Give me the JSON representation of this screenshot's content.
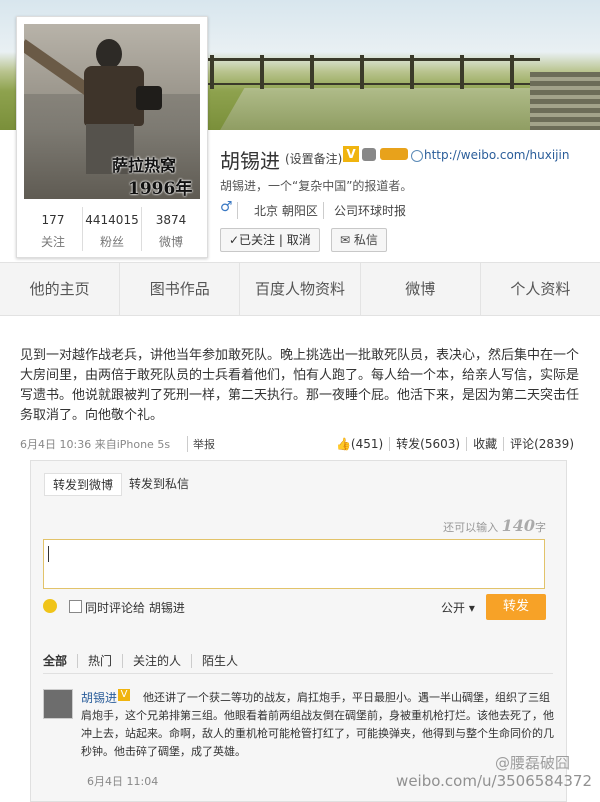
{
  "profile": {
    "name": "胡锡进",
    "note_label": "(设置备注)",
    "verified_badge": "V",
    "url": "http://weibo.com/huxijin",
    "intro": "胡锡进，一个“复杂中国”的报道者。",
    "gender_icon": "♂",
    "location": "北京 朝阳区",
    "company": "公司环球时报",
    "follow_label": "✓已关注 | 取消",
    "message_label": "✉ 私信",
    "avatar_caption_line1": "萨拉热窝",
    "avatar_caption_line2": "1996年",
    "stats": [
      {
        "value": "177",
        "label": "关注"
      },
      {
        "value": "4414015",
        "label": "粉丝"
      },
      {
        "value": "3874",
        "label": "微博"
      }
    ]
  },
  "nav": {
    "tabs": [
      "他的主页",
      "图书作品",
      "百度人物资料",
      "微博",
      "个人资料"
    ]
  },
  "post": {
    "text": "见到一对越作战老兵，讲他当年参加敢死队。晚上挑选出一批敢死队员，表决心，然后集中在一个大房间里，由两倍于敢死队员的士兵看着他们，怕有人跑了。每人给一个本，给亲人写信，实际是写遗书。他说就跟被判了死刑一样，第二天执行。那一夜睡个屁。他活下来，是因为第二天突击任务取消了。向他敬个礼。",
    "time": "6月4日 10:36  来自iPhone 5s",
    "report": "举报",
    "likes": "👍(451)",
    "repost": "转发(5603)",
    "favorite": "收藏",
    "comment": "评论(2839)"
  },
  "repost_panel": {
    "tab_active": "转发到微博",
    "tab_other": "转发到私信",
    "char_hint_prefix": "还可以输入",
    "char_hint_count": "140",
    "char_hint_suffix": "字",
    "checkbox_label": "同时评论给 胡锡进",
    "visibility": "公开 ▾",
    "send_label": "转发",
    "filters": [
      "全部",
      "热门",
      "关注的人",
      "陌生人"
    ]
  },
  "comment": {
    "name": "胡锡进",
    "v": "V",
    "text": "他还讲了一个获二等功的战友，肩扛炮手，平日最胆小。遇一半山碉堡，组织了三组肩炮手，这个兄弟排第三组。他眼看着前两组战友倒在碉堡前，身被重机枪打烂。该他去死了，他冲上去，站起来。命啊，敌人的重机枪可能枪管打红了，可能换弹夹，他得到与整个生命同价的几秒钟。他击碎了碉堡，成了英雄。",
    "time": "6月4日 11:04"
  },
  "watermark": {
    "line1": "@腰磊破囧",
    "line2": "weibo.com/u/3506584372"
  }
}
